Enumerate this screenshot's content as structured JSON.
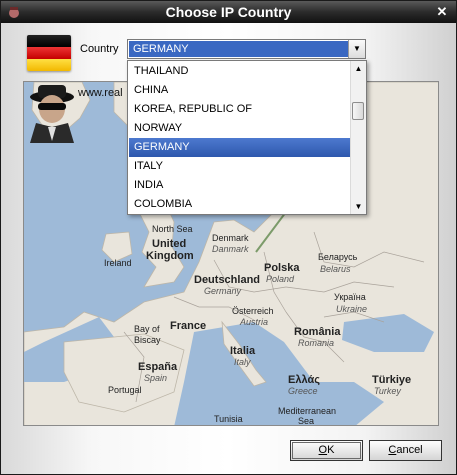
{
  "window": {
    "title": "Choose IP Country",
    "close_glyph": "✕"
  },
  "country": {
    "label": "Country",
    "selected": "GERMANY",
    "arrow_glyph": "▼",
    "options": [
      {
        "label": "THAILAND",
        "selected": false
      },
      {
        "label": "CHINA",
        "selected": false
      },
      {
        "label": "KOREA, REPUBLIC OF",
        "selected": false
      },
      {
        "label": "NORWAY",
        "selected": false
      },
      {
        "label": "GERMANY",
        "selected": true
      },
      {
        "label": "ITALY",
        "selected": false
      },
      {
        "label": "INDIA",
        "selected": false
      },
      {
        "label": "COLOMBIA",
        "selected": false
      }
    ],
    "scroll_up_glyph": "▲",
    "scroll_down_glyph": "▼"
  },
  "banner": {
    "url_text": "www.real"
  },
  "map": {
    "labels": [
      {
        "text": "North Sea",
        "style": "plain"
      },
      {
        "text": "United",
        "style": "big"
      },
      {
        "text": "Kingdom",
        "style": "big"
      },
      {
        "text": "Ireland",
        "style": "plain"
      },
      {
        "text": "Denmark",
        "style": "plain"
      },
      {
        "text": "Danmark",
        "style": "it"
      },
      {
        "text": "Deutschland",
        "style": "big"
      },
      {
        "text": "Germany",
        "style": "it"
      },
      {
        "text": "Polska",
        "style": "big"
      },
      {
        "text": "Poland",
        "style": "it"
      },
      {
        "text": "Беларусь",
        "style": "plain"
      },
      {
        "text": "Belarus",
        "style": "it"
      },
      {
        "text": "Україна",
        "style": "plain"
      },
      {
        "text": "Ukraine",
        "style": "it"
      },
      {
        "text": "Österreich",
        "style": "plain"
      },
      {
        "text": "Austria",
        "style": "it"
      },
      {
        "text": "France",
        "style": "big"
      },
      {
        "text": "Bay of",
        "style": "plain"
      },
      {
        "text": "Biscay",
        "style": "plain"
      },
      {
        "text": "România",
        "style": "big"
      },
      {
        "text": "Romania",
        "style": "it"
      },
      {
        "text": "Italia",
        "style": "big"
      },
      {
        "text": "Italy",
        "style": "it"
      },
      {
        "text": "España",
        "style": "big"
      },
      {
        "text": "Spain",
        "style": "it"
      },
      {
        "text": "Portugal",
        "style": "plain"
      },
      {
        "text": "Ελλάς",
        "style": "big"
      },
      {
        "text": "Greece",
        "style": "it"
      },
      {
        "text": "Türkiye",
        "style": "big"
      },
      {
        "text": "Turkey",
        "style": "it"
      },
      {
        "text": "Tunisia",
        "style": "plain"
      },
      {
        "text": "Mediterranean",
        "style": "plain"
      },
      {
        "text": "Sea",
        "style": "plain"
      }
    ]
  },
  "buttons": {
    "ok": {
      "mnemonic": "O",
      "rest": "K"
    },
    "cancel": {
      "mnemonic": "C",
      "rest": "ancel"
    }
  },
  "colors": {
    "selection": "#3a68c2",
    "flag_black": "#000000",
    "flag_red": "#dd0000",
    "flag_gold": "#ffce00"
  }
}
